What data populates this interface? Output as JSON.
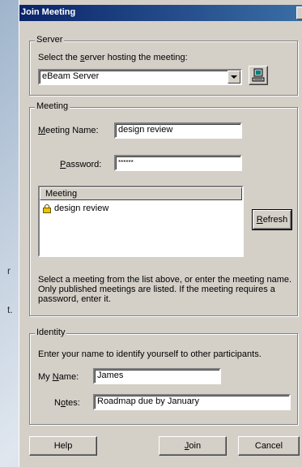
{
  "background": {
    "fragment_1": "r",
    "fragment_2": "t."
  },
  "dialog": {
    "title": "Join Meeting"
  },
  "server": {
    "legend": "Server",
    "prompt_pre": "Select the ",
    "prompt_u": "s",
    "prompt_post": "erver hosting the meeting:",
    "selected": "eBeam Server"
  },
  "meeting": {
    "legend": "Meeting",
    "name_label_u": "M",
    "name_label_rest": "eeting Name:",
    "name_value": "design review",
    "password_label_u": "P",
    "password_label_rest": "assword:",
    "password_value": "******",
    "list_header": "Meeting",
    "list_items": [
      "design review"
    ],
    "refresh_u": "R",
    "refresh_rest": "efresh",
    "help_text": "Select a meeting from the list above, or enter the meeting name. Only published meetings are listed.  If the meeting requires a password, enter it."
  },
  "identity": {
    "legend": "Identity",
    "prompt": "Enter your name to identify yourself to other participants.",
    "name_label_pre": "My ",
    "name_label_u": "N",
    "name_label_rest": "ame:",
    "name_value": "James",
    "notes_label_pre": "N",
    "notes_label_u": "o",
    "notes_label_rest": "tes:",
    "notes_value": "Roadmap due by January"
  },
  "buttons": {
    "help": "Help",
    "join_u": "J",
    "join_rest": "oin",
    "cancel": "Cancel"
  }
}
